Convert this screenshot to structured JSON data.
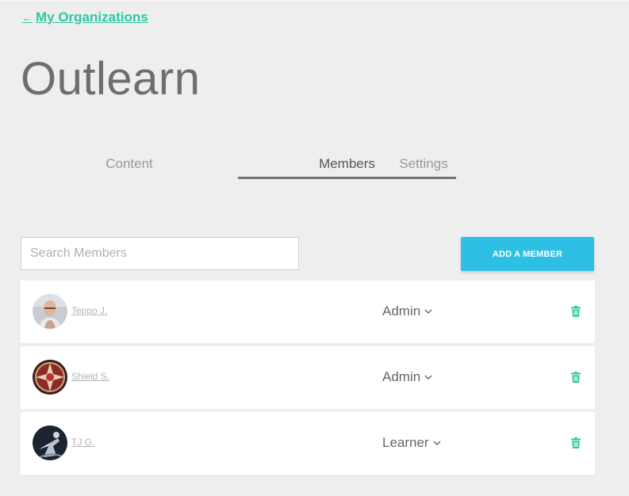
{
  "nav": {
    "back_label": "My Organizations"
  },
  "organization": {
    "name": "Outlearn"
  },
  "tabs": [
    {
      "label": "Content",
      "active": false
    },
    {
      "label": "Members",
      "active": true
    },
    {
      "label": "Settings",
      "active": false
    }
  ],
  "search": {
    "placeholder": "Search Members",
    "value": ""
  },
  "add_member_label": "ADD A MEMBER",
  "members": [
    {
      "name": "Teppo J.",
      "role": "Admin"
    },
    {
      "name": "Shield S.",
      "role": "Admin"
    },
    {
      "name": "TJ G.",
      "role": "Learner"
    }
  ],
  "colors": {
    "accent_green": "#2cc9a0",
    "button_blue": "#2ec0e4"
  },
  "icons": [
    "back-arrow-icon",
    "chevron-down-icon",
    "trash-icon"
  ]
}
